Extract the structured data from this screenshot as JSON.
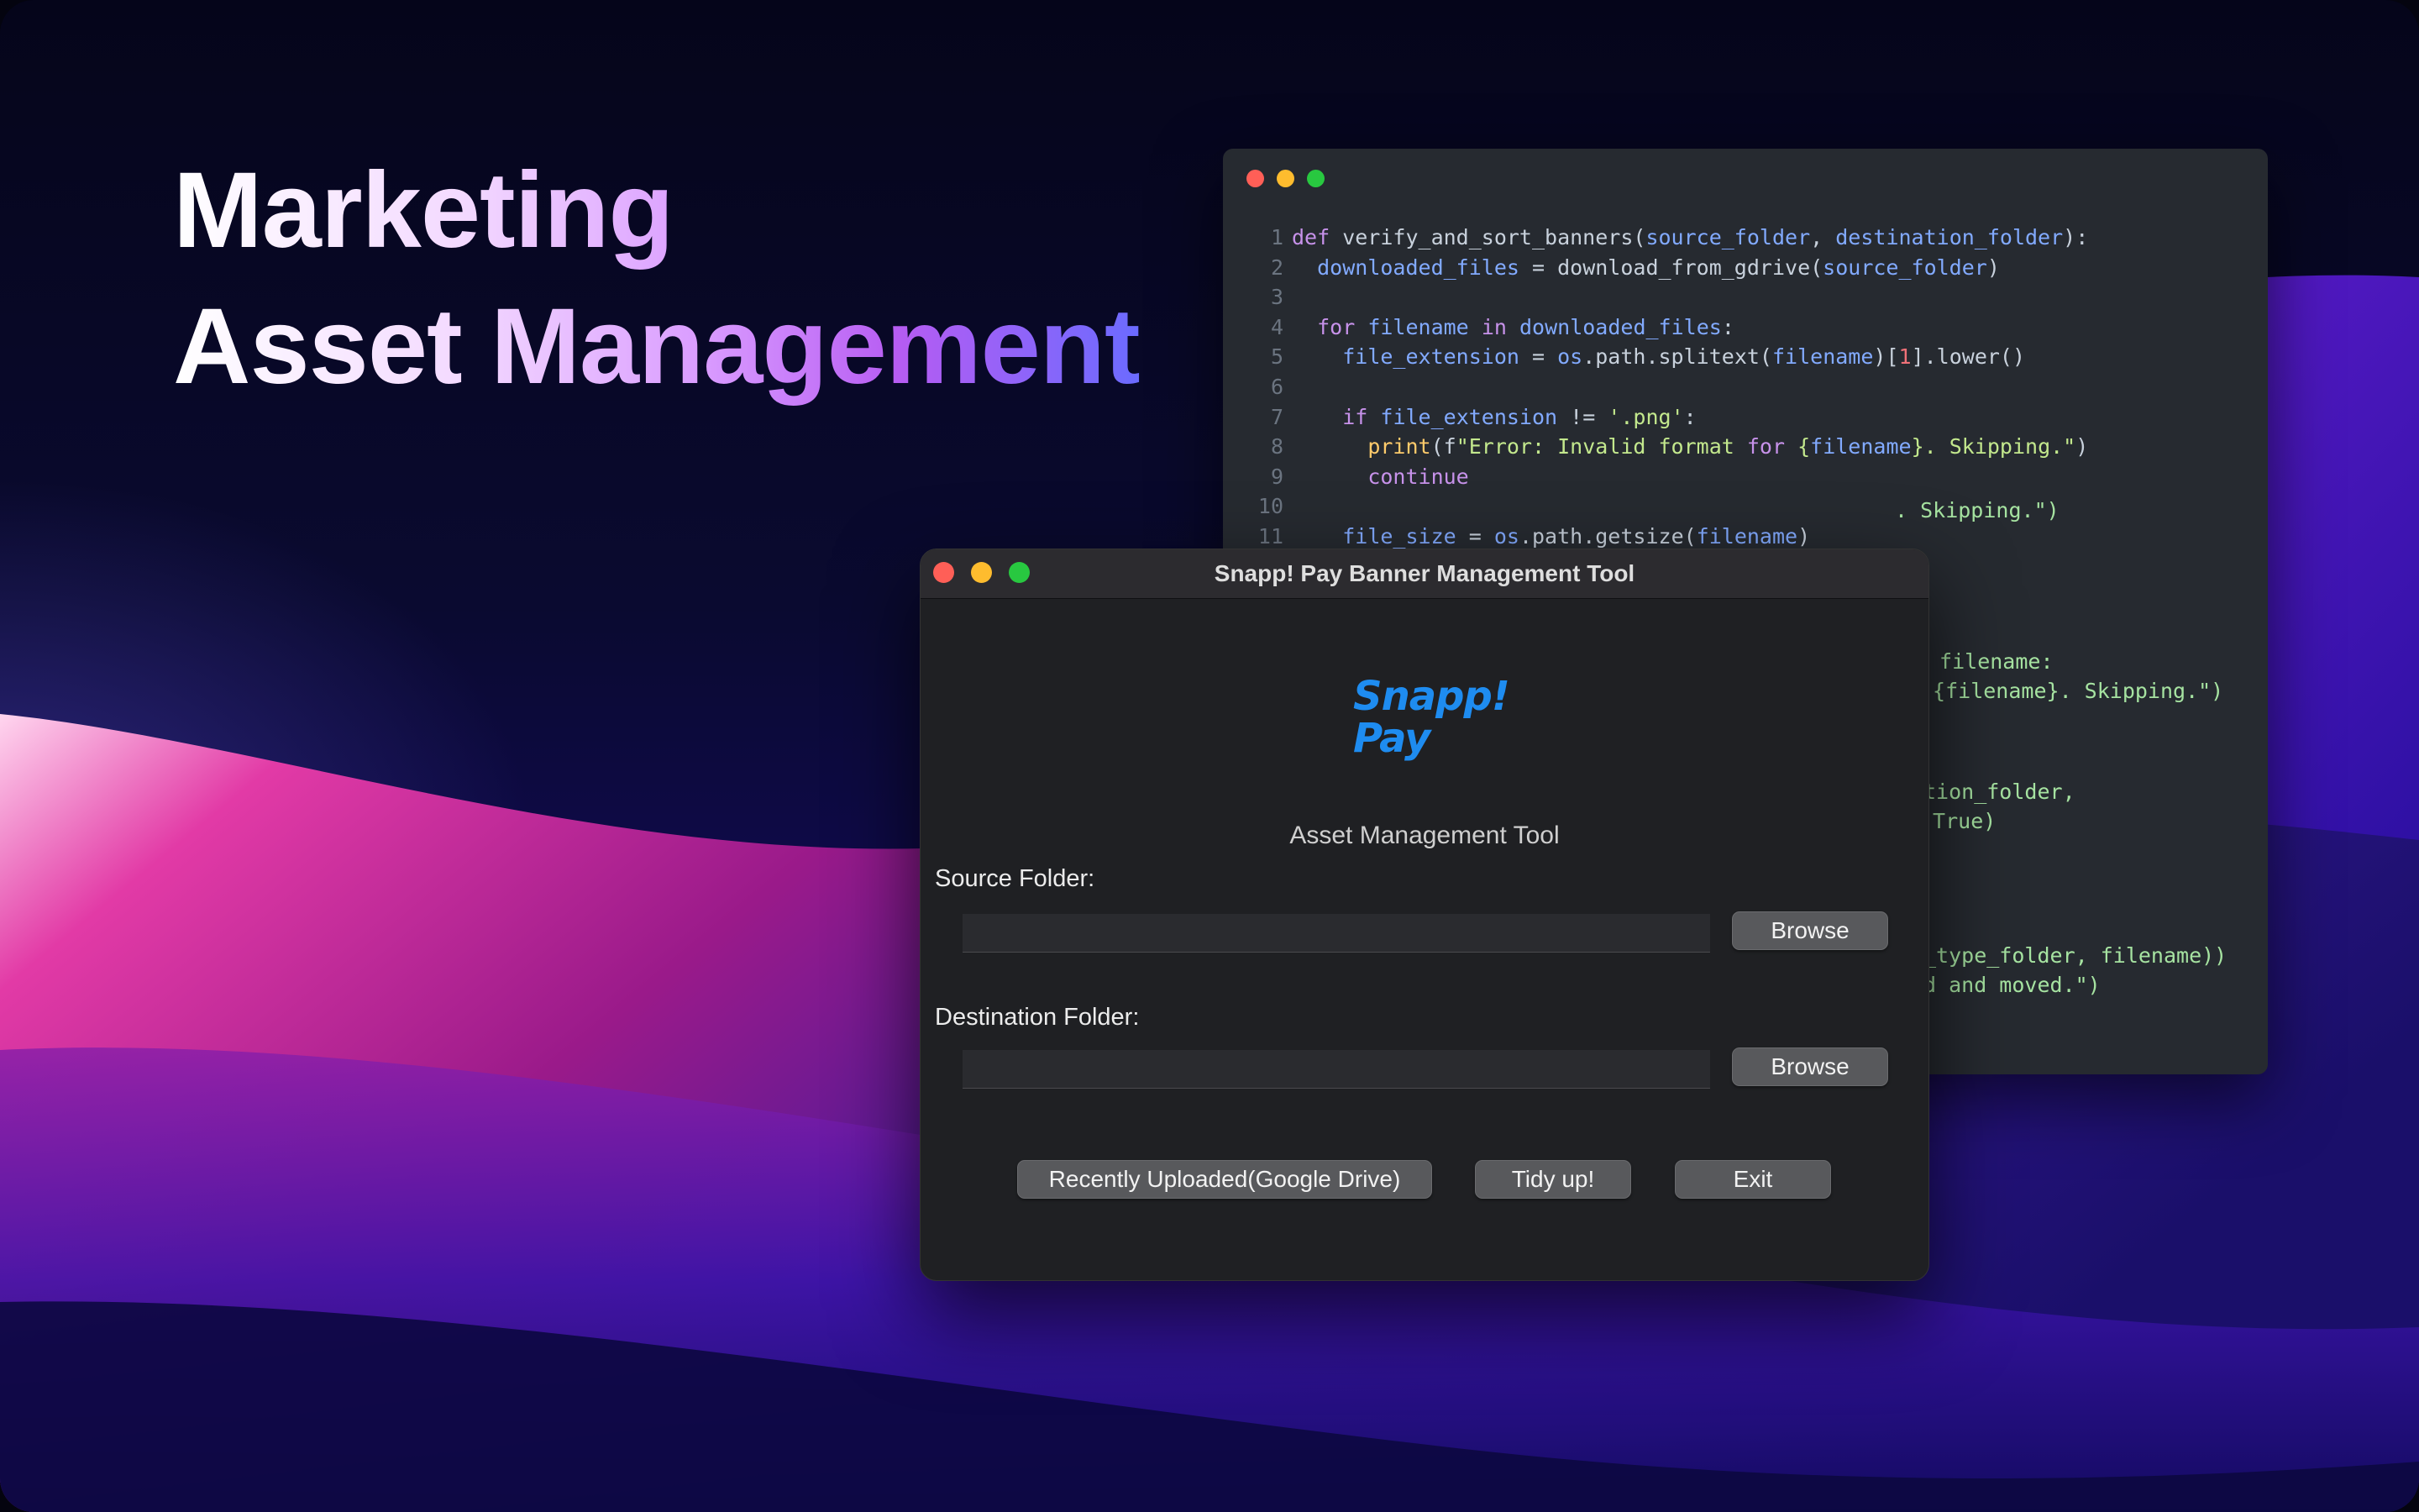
{
  "hero": {
    "line1": "Marketing",
    "line2": "Asset Management"
  },
  "editor": {
    "lines": [
      {
        "n": "1",
        "t": "def verify_and_sort_banners(source_folder, destination_folder):"
      },
      {
        "n": "2",
        "t": "  downloaded_files = download_from_gdrive(source_folder)"
      },
      {
        "n": "3",
        "t": ""
      },
      {
        "n": "4",
        "t": "  for filename in downloaded_files:"
      },
      {
        "n": "5",
        "t": "    file_extension = os.path.splitext(filename)[1].lower()"
      },
      {
        "n": "6",
        "t": ""
      },
      {
        "n": "7",
        "t": "    if file_extension != '.png':"
      },
      {
        "n": "8",
        "t": "      print(f\"Error: Invalid format for {filename}. Skipping.\")"
      },
      {
        "n": "9",
        "t": "      continue"
      },
      {
        "n": "10",
        "t": ""
      },
      {
        "n": "11",
        "t": "    file_size = os.path.getsize(filename)"
      }
    ],
    "partial_lines": [
      ". Skipping.\")",
      " filename:",
      " {filename}. Skipping.\")",
      "tion_folder,",
      " True)",
      "_type_folder, filename))",
      "d and moved.\")"
    ]
  },
  "app": {
    "title": "Snapp! Pay Banner Management Tool",
    "logo_line1": "Snapp!",
    "logo_line2": "Pay",
    "subtitle": "Asset Management Tool",
    "source_label": "Source Folder:",
    "source_value": "",
    "destination_label": "Destination Folder:",
    "destination_value": "",
    "browse_label": "Browse",
    "recent_label": "Recently Uploaded(Google Drive)",
    "tidy_label": "Tidy up!",
    "exit_label": "Exit",
    "logo_color": "#1e8cf0"
  }
}
